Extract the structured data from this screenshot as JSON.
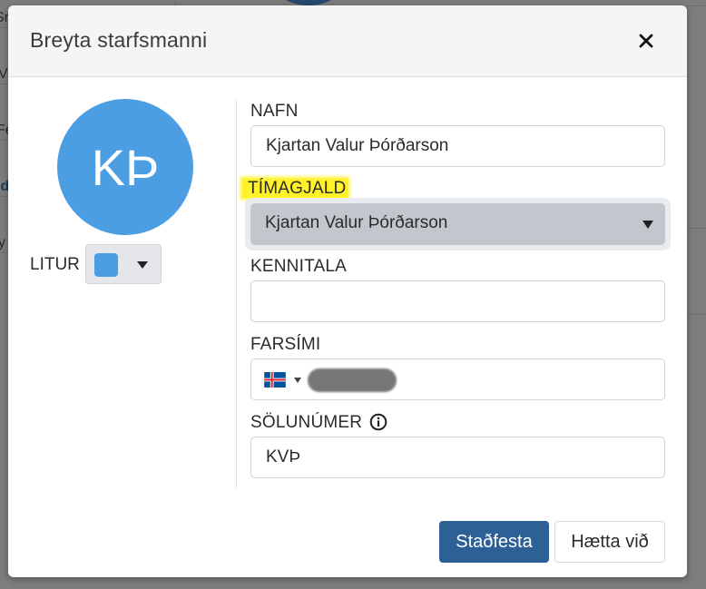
{
  "background": {
    "row_fragments": [
      "Sr",
      "Vi",
      "Fe",
      "Id",
      "y"
    ]
  },
  "dialog": {
    "title": "Breyta starfsmanni",
    "close_icon": "close-x-icon",
    "avatar": {
      "initials": "KÞ",
      "color": "#4c9ee3"
    },
    "color_picker": {
      "label": "LITUR",
      "selected_color": "#4c9ee3"
    },
    "fields": {
      "name": {
        "label": "NAFN",
        "value": "Kjartan Valur Þórðarson"
      },
      "hourly_rate": {
        "label": "TÍMAGJALD",
        "selected": "Kjartan Valur Þórðarson",
        "highlight_color": "#fff22a"
      },
      "kennitala": {
        "label": "KENNITALA",
        "value": ""
      },
      "mobile": {
        "label": "FARSÍMI",
        "country_flag": "iceland-flag-icon"
      },
      "sales_number": {
        "label": "SÖLUNÚMER",
        "value": "KVÞ",
        "info_icon": "info-icon"
      }
    },
    "buttons": {
      "confirm": "Staðfesta",
      "cancel": "Hætta við"
    },
    "colors": {
      "primary_button": "#2d6196",
      "header_bg": "#f5f5f5"
    }
  }
}
